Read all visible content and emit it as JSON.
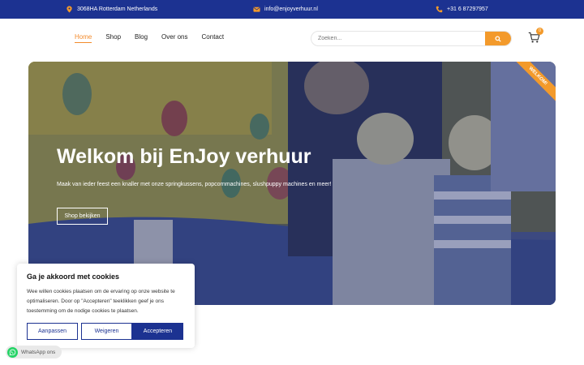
{
  "topbar": {
    "address": "3068HA Rotterdam Netherlands",
    "email": "info@enjoyverhuur.nl",
    "phone": "+31 6 87297957"
  },
  "nav": {
    "items": [
      {
        "label": "Home",
        "active": true
      },
      {
        "label": "Shop",
        "active": false
      },
      {
        "label": "Blog",
        "active": false
      },
      {
        "label": "Over ons",
        "active": false
      },
      {
        "label": "Contact",
        "active": false
      }
    ],
    "search_placeholder": "Zoeken...",
    "cart_count": "0"
  },
  "hero": {
    "title": "Welkom bij EnJoy verhuur",
    "subtitle": "Maak van ieder feest een knaller met onze springkussens, popcornmachines, slushpuppy machines en meer!",
    "button": "Shop bekijken",
    "ribbon": "WELKOM!"
  },
  "cookie": {
    "title": "Ga je akkoord met cookies",
    "text": "Wee willen cookies plaatsen om de ervaring op onze website te optimaliseren. Door op \"Accepteren\" teeklikken geef je ons toestemming om de nodige cookies te plaatsen.",
    "customize": "Aanpassen",
    "reject": "Weigeren",
    "accept": "Accepteren"
  },
  "whatsapp": {
    "label": "WhatsApp ons"
  },
  "colors": {
    "brand_blue": "#1c3291",
    "accent_orange": "#f39a2b"
  }
}
